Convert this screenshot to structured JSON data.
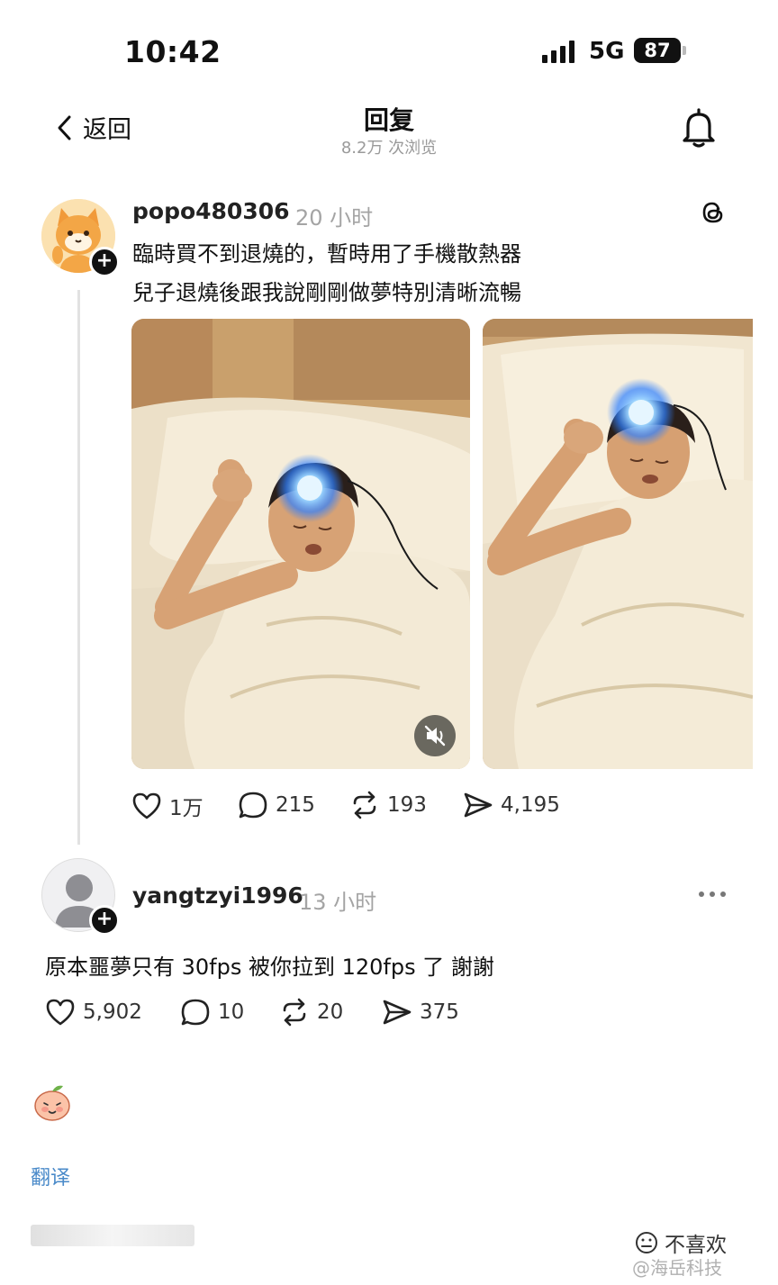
{
  "status": {
    "time": "10:42",
    "network": "5G",
    "battery": "87"
  },
  "nav": {
    "back_label": "返回",
    "title": "回复",
    "views": "8.2万 次浏览"
  },
  "post": {
    "username": "popo480306",
    "time": "20 小时",
    "line1": "臨時買不到退燒的，暫時用了手機散熱器",
    "line2": "兒子退燒後跟我說剛剛做夢特別清晰流暢",
    "actions": {
      "likes": "1万",
      "comments": "215",
      "reposts": "193",
      "shares": "4,195"
    }
  },
  "reply": {
    "username": "yangtzyi1996",
    "time": "13 小时",
    "text": "原本噩夢只有 30fps 被你拉到 120fps 了 謝謝",
    "actions": {
      "likes": "5,902",
      "comments": "10",
      "reposts": "20",
      "shares": "375"
    }
  },
  "footer": {
    "translate": "翻译",
    "dislike": "不喜欢",
    "watermark": "@海岳科技"
  }
}
